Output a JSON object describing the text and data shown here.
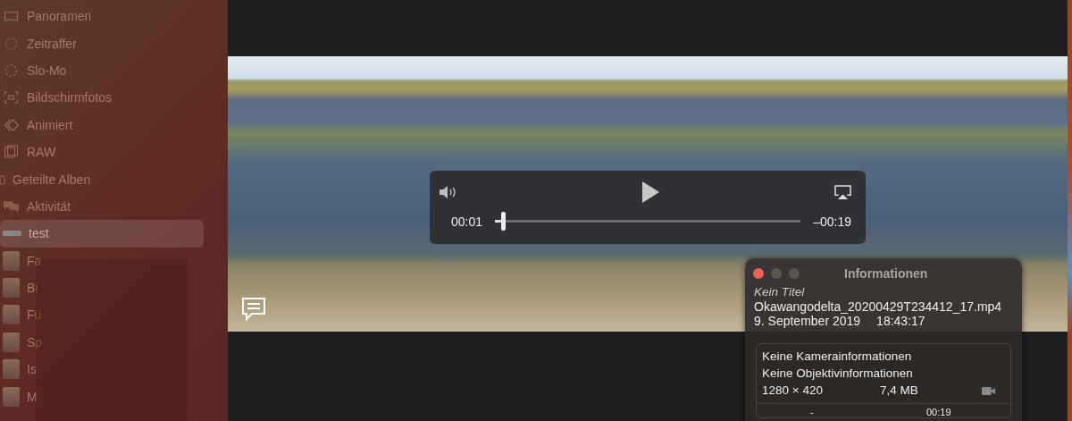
{
  "sidebar": {
    "media_types": [
      {
        "label": "Panoramen"
      },
      {
        "label": "Zeitraffer"
      },
      {
        "label": "Slo-Mo"
      },
      {
        "label": "Bildschirmfotos"
      },
      {
        "label": "Animiert"
      },
      {
        "label": "RAW"
      }
    ],
    "shared_albums": {
      "label": "Geteilte Alben",
      "children": [
        {
          "label": "Aktivität",
          "kind": "icon",
          "selected": false
        },
        {
          "label": "test",
          "kind": "thumb",
          "selected": true
        },
        {
          "label": "Fa",
          "kind": "thumb",
          "selected": false
        },
        {
          "label": "Bi",
          "kind": "thumb",
          "selected": false
        },
        {
          "label": "Fü",
          "kind": "thumb",
          "selected": false
        },
        {
          "label": "Sp",
          "kind": "thumb",
          "selected": false
        },
        {
          "label": "Is",
          "kind": "thumb",
          "selected": false
        },
        {
          "label": "M",
          "kind": "thumb",
          "selected": false
        }
      ]
    }
  },
  "player": {
    "elapsed": "00:01",
    "remaining": "–00:19",
    "level": 0.02
  },
  "info": {
    "title": "Informationen",
    "caption": "Kein Titel",
    "filename": "Okawangodelta_20200429T234412_17.mp4",
    "date": "9. September 2019",
    "time": "18:43:17",
    "camera": "Keine Kamerainformationen",
    "lens": "Keine Objektivinformationen",
    "dimensions": "1280 × 420",
    "size": "7,4 MB",
    "column_1": "-",
    "duration": "00:19"
  }
}
